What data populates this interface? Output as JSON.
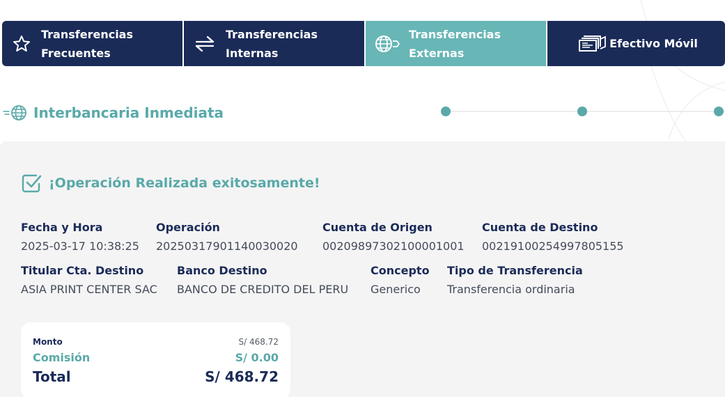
{
  "tabs": [
    {
      "label": "Transferencias\nFrecuentes",
      "icon": "star-icon",
      "active": false
    },
    {
      "label": "Transferencias\nInternas",
      "icon": "swap-arrows-icon",
      "active": false
    },
    {
      "label": "Transferencias\nExternas",
      "icon": "globe-transfer-icon",
      "active": true
    },
    {
      "label": "Efectivo Móvil",
      "icon": "cash-bills-icon",
      "active": false
    }
  ],
  "section": {
    "title": "Interbancaria Inmediata",
    "icon": "globe-fast-icon",
    "steps_total": 3
  },
  "result": {
    "success_message": "¡Operación Realizada exitosamente!",
    "fields": {
      "fecha": {
        "label": "Fecha y Hora",
        "value": "2025-03-17 10:38:25"
      },
      "operacion": {
        "label": "Operación",
        "value": "20250317901140030020"
      },
      "cuenta_origen": {
        "label": "Cuenta de Origen",
        "value": "00209897302100001001"
      },
      "cuenta_destino": {
        "label": "Cuenta de Destino",
        "value": "00219100254997805155"
      },
      "titular": {
        "label": "Titular Cta. Destino",
        "value": "ASIA PRINT CENTER SAC"
      },
      "banco": {
        "label": "Banco Destino",
        "value": "BANCO DE CREDITO DEL PERU"
      },
      "concepto": {
        "label": "Concepto",
        "value": "Generico"
      },
      "tipo": {
        "label": "Tipo de Transferencia",
        "value": "Transferencia ordinaria"
      }
    }
  },
  "summary": {
    "monto_label": "Monto",
    "monto_value": "S/ 468.72",
    "comision_label": "Comisión",
    "comision_value": "S/ 0.00",
    "total_label": "Total",
    "total_value": "S/ 468.72"
  },
  "colors": {
    "navy": "#1b2b58",
    "teal": "#68b6b6",
    "teal_text": "#5aa9a9",
    "card_bg": "#f4f4f4"
  }
}
